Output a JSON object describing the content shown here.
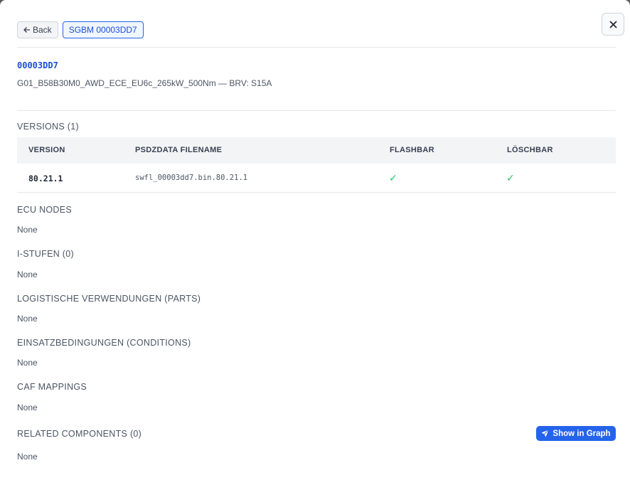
{
  "header": {
    "back_label": "Back",
    "breadcrumb_label": "SGBM 00003DD7",
    "close_icon": "close-icon"
  },
  "ecu": {
    "id": "00003DD7",
    "description": "G01_B58B30M0_AWD_ECE_EU6c_265kW_500Nm — BRV: S15A"
  },
  "versions": {
    "title": "VERSIONS (1)",
    "columns": [
      "VERSION",
      "PSDZDATA FILENAME",
      "FLASHBAR",
      "LÖSCHBAR"
    ],
    "rows": [
      {
        "version": "80.21.1",
        "filename": "swfl_00003dd7.bin.80.21.1",
        "flashbar": "✓",
        "loeschbar": "✓"
      }
    ]
  },
  "sections": {
    "ecu_nodes": {
      "title": "ECU NODES",
      "value": "None"
    },
    "i_stufen": {
      "title": "I-STUFEN (0)",
      "value": "None"
    },
    "parts": {
      "title": "LOGISTISCHE VERWENDUNGEN (PARTS)",
      "value": "None"
    },
    "conditions": {
      "title": "EINSATZBEDINGUNGEN (CONDITIONS)",
      "value": "None"
    },
    "caf": {
      "title": "CAF MAPPINGS",
      "value": "None"
    },
    "related": {
      "title": "RELATED COMPONENTS (0)",
      "value": "None",
      "graph_button": "Show in Graph"
    }
  },
  "colors": {
    "accent": "#2563eb",
    "check": "#22c55e"
  }
}
